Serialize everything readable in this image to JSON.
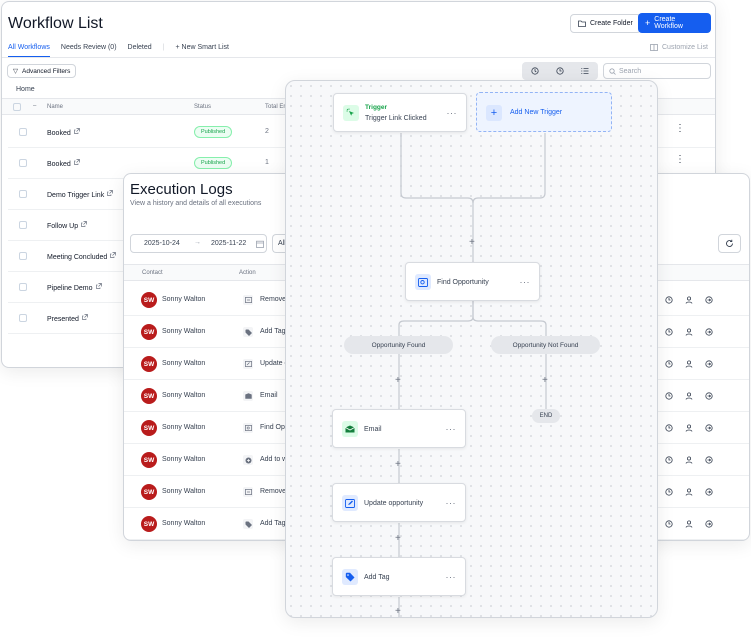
{
  "workflow_list": {
    "title": "Workflow List",
    "create_folder": "Create Folder",
    "create_workflow": "Create Workflow",
    "tabs": [
      "All Workflows",
      "Needs Review (0)",
      "Deleted"
    ],
    "new_smart_list": "New Smart List",
    "customize_list": "Customize List",
    "advanced_filters": "Advanced Filters",
    "search_placeholder": "Search",
    "breadcrumb": "Home",
    "columns": [
      "Name",
      "Status",
      "Total En"
    ],
    "rows": [
      {
        "name": "Booked",
        "status": "Published",
        "count": "2"
      },
      {
        "name": "Booked",
        "status": "Published",
        "count": "1"
      },
      {
        "name": "Demo Trigger Link",
        "status": "",
        "count": ""
      },
      {
        "name": "Follow Up",
        "status": "",
        "count": ""
      },
      {
        "name": "Meeting Concluded",
        "status": "",
        "count": ""
      },
      {
        "name": "Pipeline Demo",
        "status": "",
        "count": ""
      },
      {
        "name": "Presented",
        "status": "",
        "count": ""
      }
    ]
  },
  "execution_logs": {
    "title": "Execution Logs",
    "subtitle": "View a history and details of all executions",
    "date_from": "2025-10-24",
    "date_to": "2025-11-22",
    "filter_partial": "All",
    "columns": [
      "Contact",
      "Action"
    ],
    "rows": [
      {
        "initials": "SW",
        "name": "Sonny Walton",
        "action": "Remove",
        "icon": "remove-icon"
      },
      {
        "initials": "SW",
        "name": "Sonny Walton",
        "action": "Add Tag",
        "icon": "tag-icon"
      },
      {
        "initials": "SW",
        "name": "Sonny Walton",
        "action": "Update c",
        "icon": "update-icon"
      },
      {
        "initials": "SW",
        "name": "Sonny Walton",
        "action": "Email",
        "icon": "email-icon"
      },
      {
        "initials": "SW",
        "name": "Sonny Walton",
        "action": "Find Opp",
        "icon": "find-icon"
      },
      {
        "initials": "SW",
        "name": "Sonny Walton",
        "action": "Add to w",
        "icon": "add-icon"
      },
      {
        "initials": "SW",
        "name": "Sonny Walton",
        "action": "Remove",
        "icon": "remove-icon"
      },
      {
        "initials": "SW",
        "name": "Sonny Walton",
        "action": "Add Tag",
        "icon": "tag-icon"
      }
    ]
  },
  "builder": {
    "trigger_label": "Trigger",
    "trigger_name": "Trigger Link Clicked",
    "add_trigger": "Add New Trigger",
    "find_opportunity": "Find Opportunity",
    "branch_found": "Opportunity Found",
    "branch_not_found": "Opportunity Not Found",
    "end": "END",
    "email": "Email",
    "update_opportunity": "Update opportunity",
    "add_tag": "Add Tag",
    "plus": "+",
    "kebab": "···"
  },
  "colors": {
    "primary": "#155eef",
    "published_green": "#16a34a",
    "avatar_red": "#b91c1c"
  }
}
